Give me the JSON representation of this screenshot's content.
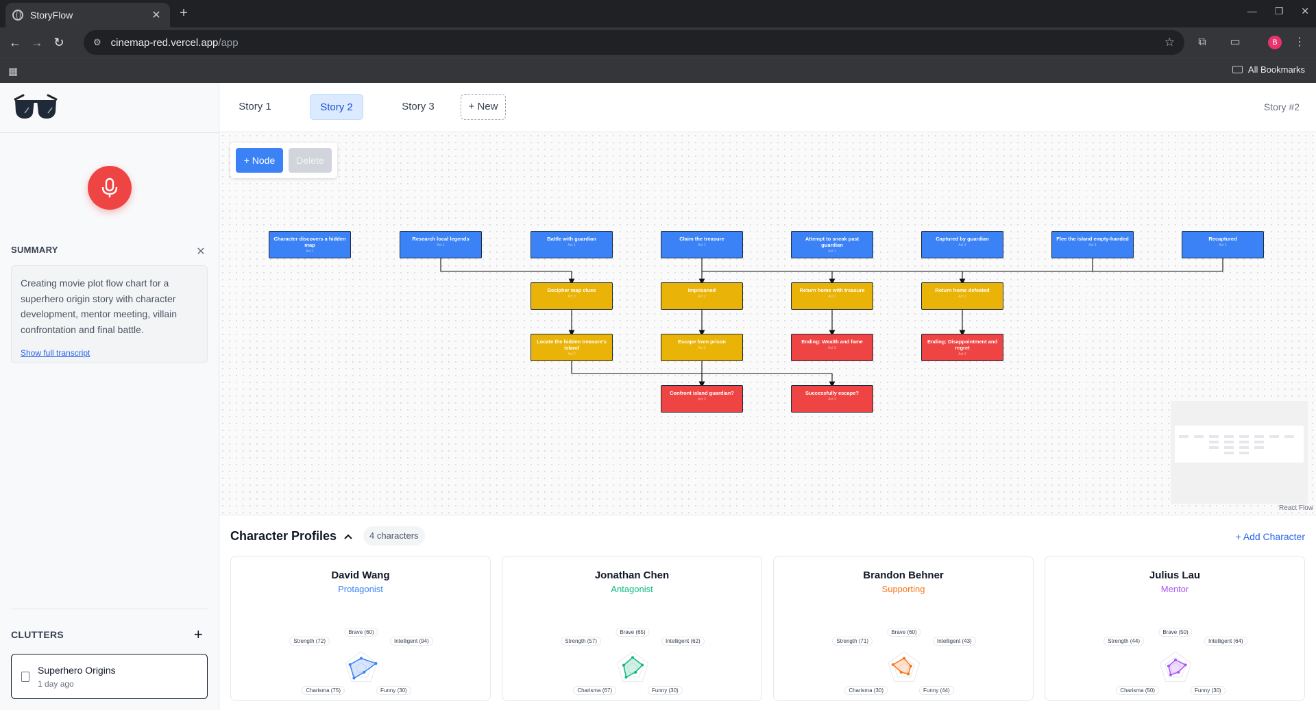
{
  "browser": {
    "tab_title": "StoryFlow",
    "url_host": "cinemap-red.vercel.app",
    "url_path": "/app",
    "profile_initial": "B",
    "bookmarks_label": "All Bookmarks"
  },
  "sidebar": {
    "summary_heading": "SUMMARY",
    "summary_text": "Creating movie plot flow chart for a superhero origin story with character development, mentor meeting, villain confrontation and final battle.",
    "transcript_link": "Show full transcript",
    "clutters_heading": "CLUTTERS",
    "clutters": [
      {
        "title": "Superhero Origins",
        "subtitle": "1 day ago"
      }
    ]
  },
  "story_tabs": {
    "tabs": [
      "Story 1",
      "Story 2",
      "Story 3"
    ],
    "active": "Story 2",
    "new_label": "+ New",
    "story_id": "Story #2"
  },
  "canvas": {
    "add_node_label": "+ Node",
    "delete_label": "Delete",
    "attribution": "React Flow",
    "colors": {
      "act1": "#3b82f6",
      "act2": "#eab308",
      "act3": "#ef4444"
    },
    "nodes": [
      {
        "id": "n1",
        "title": "Character discovers a hidden map",
        "act": "Act 1"
      },
      {
        "id": "n2",
        "title": "Research local legends",
        "act": "Act 1"
      },
      {
        "id": "n3",
        "title": "Battle with guardian",
        "act": "Act 1"
      },
      {
        "id": "n4",
        "title": "Claim the treasure",
        "act": "Act 1"
      },
      {
        "id": "n5",
        "title": "Attempt to sneak past guardian",
        "act": "Act 1"
      },
      {
        "id": "n6",
        "title": "Captured by guardian",
        "act": "Act 1"
      },
      {
        "id": "n7",
        "title": "Flee the island empty-handed",
        "act": "Act 1"
      },
      {
        "id": "n8",
        "title": "Recaptured",
        "act": "Act 1"
      },
      {
        "id": "n9",
        "title": "Decipher map clues",
        "act": "Act 2"
      },
      {
        "id": "n10",
        "title": "Imprisoned",
        "act": "Act 2"
      },
      {
        "id": "n11",
        "title": "Return home with treasure",
        "act": "Act 2"
      },
      {
        "id": "n12",
        "title": "Return home defeated",
        "act": "Act 2"
      },
      {
        "id": "n13",
        "title": "Locate the hidden treasure's island",
        "act": "Act 2"
      },
      {
        "id": "n14",
        "title": "Escape from prison",
        "act": "Act 2"
      },
      {
        "id": "n15",
        "title": "Ending: Wealth and fame",
        "act": "Act 3"
      },
      {
        "id": "n16",
        "title": "Ending: Disappointment and regret",
        "act": "Act 3"
      },
      {
        "id": "n17",
        "title": "Confront island guardian?",
        "act": "Act 3"
      },
      {
        "id": "n18",
        "title": "Successfully escape?",
        "act": "Act 3"
      }
    ]
  },
  "characters": {
    "heading": "Character Profiles",
    "count_label": "4 characters",
    "add_label": "+ Add Character",
    "list": [
      {
        "name": "David Wang",
        "role": "Protagonist",
        "color": "#3b82f6",
        "stats": {
          "Brave": 60,
          "Intelligent": 94,
          "Funny": 30,
          "Charisma": 75,
          "Strength": 72
        }
      },
      {
        "name": "Jonathan Chen",
        "role": "Antagonist",
        "color": "#10b981",
        "stats": {
          "Brave": 65,
          "Intelligent": 62,
          "Funny": 30,
          "Charisma": 67,
          "Strength": 57
        }
      },
      {
        "name": "Brandon Behner",
        "role": "Supporting",
        "color": "#f97316",
        "stats": {
          "Brave": 60,
          "Intelligent": 43,
          "Funny": 44,
          "Charisma": 30,
          "Strength": 71
        }
      },
      {
        "name": "Julius Lau",
        "role": "Mentor",
        "color": "#a855f7",
        "stats": {
          "Brave": 50,
          "Intelligent": 64,
          "Funny": 30,
          "Charisma": 50,
          "Strength": 44
        }
      }
    ]
  }
}
